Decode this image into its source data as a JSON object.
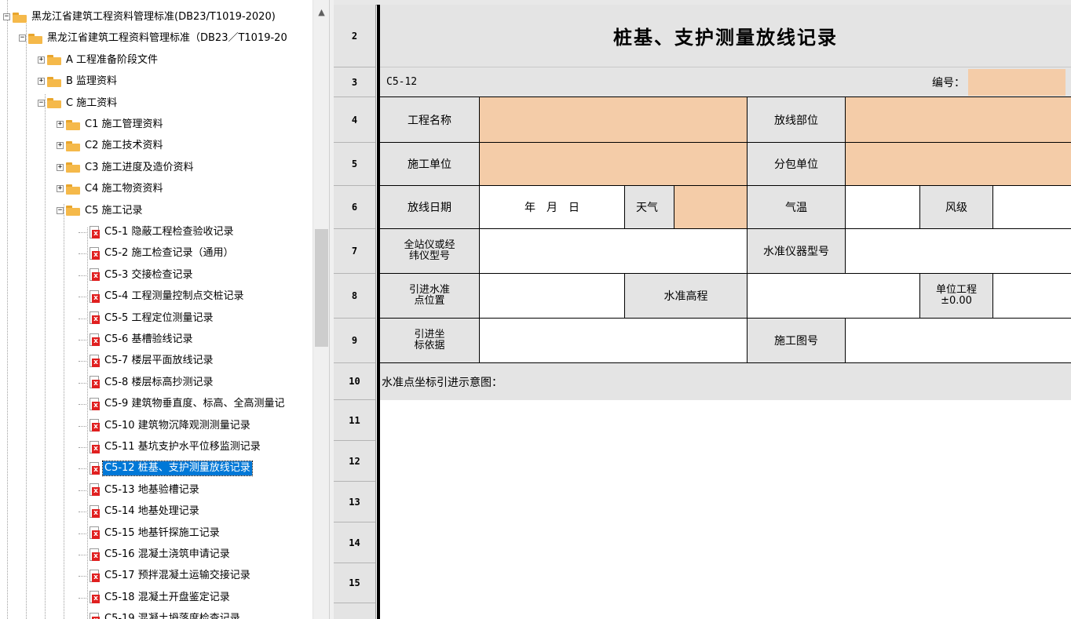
{
  "tree": {
    "nodes": [
      {
        "label": "黑龙江省建筑工程资料管理标准(DB23/T1019-2020)",
        "level": 0,
        "type": "folder",
        "expander": "minus"
      },
      {
        "label": "黑龙江省建筑工程资料管理标准（DB23／T1019-20",
        "level": 1,
        "type": "folder",
        "expander": "minus"
      },
      {
        "label": "A 工程准备阶段文件",
        "level": 2,
        "type": "folder",
        "expander": "plus"
      },
      {
        "label": "B 监理资料",
        "level": 2,
        "type": "folder",
        "expander": "plus"
      },
      {
        "label": "C 施工资料",
        "level": 2,
        "type": "folder",
        "expander": "minus"
      },
      {
        "label": "C1 施工管理资料",
        "level": 3,
        "type": "folder",
        "expander": "plus"
      },
      {
        "label": "C2 施工技术资料",
        "level": 3,
        "type": "folder",
        "expander": "plus"
      },
      {
        "label": "C3 施工进度及造价资料",
        "level": 3,
        "type": "folder",
        "expander": "plus"
      },
      {
        "label": "C4 施工物资资料",
        "level": 3,
        "type": "folder",
        "expander": "plus"
      },
      {
        "label": "C5 施工记录",
        "level": 3,
        "type": "folder",
        "expander": "minus"
      },
      {
        "label": "C5-1 隐蔽工程检查验收记录",
        "level": 4,
        "type": "file"
      },
      {
        "label": "C5-2 施工检查记录（通用）",
        "level": 4,
        "type": "file"
      },
      {
        "label": "C5-3 交接检查记录",
        "level": 4,
        "type": "file"
      },
      {
        "label": "C5-4 工程测量控制点交桩记录",
        "level": 4,
        "type": "file"
      },
      {
        "label": "C5-5 工程定位测量记录",
        "level": 4,
        "type": "file"
      },
      {
        "label": "C5-6 基槽验线记录",
        "level": 4,
        "type": "file"
      },
      {
        "label": "C5-7 楼层平面放线记录",
        "level": 4,
        "type": "file"
      },
      {
        "label": "C5-8 楼层标高抄测记录",
        "level": 4,
        "type": "file"
      },
      {
        "label": "C5-9 建筑物垂直度、标高、全高测量记",
        "level": 4,
        "type": "file"
      },
      {
        "label": "C5-10 建筑物沉降观测测量记录",
        "level": 4,
        "type": "file"
      },
      {
        "label": "C5-11 基坑支护水平位移监测记录",
        "level": 4,
        "type": "file"
      },
      {
        "label": "C5-12 桩基、支护测量放线记录",
        "level": 4,
        "type": "file",
        "selected": true
      },
      {
        "label": "C5-13 地基验槽记录",
        "level": 4,
        "type": "file"
      },
      {
        "label": "C5-14 地基处理记录",
        "level": 4,
        "type": "file"
      },
      {
        "label": "C5-15 地基钎探施工记录",
        "level": 4,
        "type": "file"
      },
      {
        "label": "C5-16 混凝土浇筑申请记录",
        "level": 4,
        "type": "file"
      },
      {
        "label": "C5-17 预拌混凝土运输交接记录",
        "level": 4,
        "type": "file"
      },
      {
        "label": "C5-18 混凝土开盘鉴定记录",
        "level": 4,
        "type": "file"
      },
      {
        "label": "C5-19 混凝土坍落度检查记录",
        "level": 4,
        "type": "file"
      }
    ]
  },
  "sheet": {
    "row_numbers": [
      "2",
      "3",
      "4",
      "5",
      "6",
      "7",
      "8",
      "9",
      "10",
      "11",
      "12",
      "13",
      "14",
      "15"
    ],
    "title": "桩基、支护测量放线记录",
    "form_code": "C5-12",
    "number_label": "编号：",
    "project_name_label": "工程名称",
    "layout_location_label": "放线部位",
    "construction_unit_label": "施工单位",
    "subcontract_unit_label": "分包单位",
    "layout_date_label": "放线日期",
    "date_placeholder": "年　月　日",
    "weather_label": "天气",
    "temperature_label": "气温",
    "wind_label": "风级",
    "total_station_label": "全站仪或经纬仪型号",
    "level_instrument_label": "水准仪器型号",
    "benchmark_location_label": "引进水准点位置",
    "benchmark_elevation_label": "水准高程",
    "unit_project_label": "单位工程±0.00",
    "coordinate_basis_label": "引进坐标依据",
    "drawing_number_label": "施工图号",
    "diagram_label": "水准点坐标引进示意图："
  },
  "colors": {
    "input_fill": "#f4cca8",
    "label_fill": "#e4e4e4",
    "selection": "#0078d7",
    "folder": "#f5b94a",
    "file_mark": "#e02020"
  }
}
